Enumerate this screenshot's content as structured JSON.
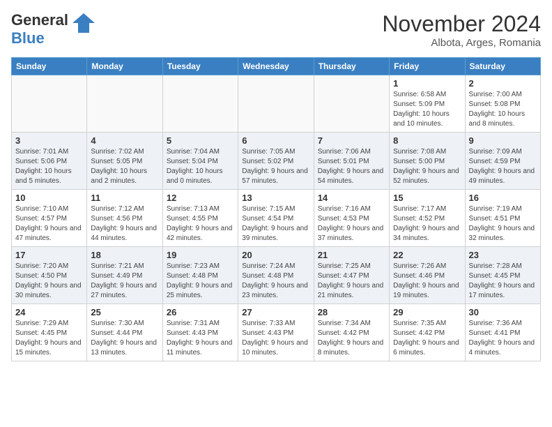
{
  "header": {
    "logo_general": "General",
    "logo_blue": "Blue",
    "month_title": "November 2024",
    "location": "Albota, Arges, Romania"
  },
  "days_of_week": [
    "Sunday",
    "Monday",
    "Tuesday",
    "Wednesday",
    "Thursday",
    "Friday",
    "Saturday"
  ],
  "weeks": [
    {
      "days": [
        {
          "number": "",
          "info": ""
        },
        {
          "number": "",
          "info": ""
        },
        {
          "number": "",
          "info": ""
        },
        {
          "number": "",
          "info": ""
        },
        {
          "number": "",
          "info": ""
        },
        {
          "number": "1",
          "info": "Sunrise: 6:58 AM\nSunset: 5:09 PM\nDaylight: 10 hours and 10 minutes."
        },
        {
          "number": "2",
          "info": "Sunrise: 7:00 AM\nSunset: 5:08 PM\nDaylight: 10 hours and 8 minutes."
        }
      ]
    },
    {
      "days": [
        {
          "number": "3",
          "info": "Sunrise: 7:01 AM\nSunset: 5:06 PM\nDaylight: 10 hours and 5 minutes."
        },
        {
          "number": "4",
          "info": "Sunrise: 7:02 AM\nSunset: 5:05 PM\nDaylight: 10 hours and 2 minutes."
        },
        {
          "number": "5",
          "info": "Sunrise: 7:04 AM\nSunset: 5:04 PM\nDaylight: 10 hours and 0 minutes."
        },
        {
          "number": "6",
          "info": "Sunrise: 7:05 AM\nSunset: 5:02 PM\nDaylight: 9 hours and 57 minutes."
        },
        {
          "number": "7",
          "info": "Sunrise: 7:06 AM\nSunset: 5:01 PM\nDaylight: 9 hours and 54 minutes."
        },
        {
          "number": "8",
          "info": "Sunrise: 7:08 AM\nSunset: 5:00 PM\nDaylight: 9 hours and 52 minutes."
        },
        {
          "number": "9",
          "info": "Sunrise: 7:09 AM\nSunset: 4:59 PM\nDaylight: 9 hours and 49 minutes."
        }
      ]
    },
    {
      "days": [
        {
          "number": "10",
          "info": "Sunrise: 7:10 AM\nSunset: 4:57 PM\nDaylight: 9 hours and 47 minutes."
        },
        {
          "number": "11",
          "info": "Sunrise: 7:12 AM\nSunset: 4:56 PM\nDaylight: 9 hours and 44 minutes."
        },
        {
          "number": "12",
          "info": "Sunrise: 7:13 AM\nSunset: 4:55 PM\nDaylight: 9 hours and 42 minutes."
        },
        {
          "number": "13",
          "info": "Sunrise: 7:15 AM\nSunset: 4:54 PM\nDaylight: 9 hours and 39 minutes."
        },
        {
          "number": "14",
          "info": "Sunrise: 7:16 AM\nSunset: 4:53 PM\nDaylight: 9 hours and 37 minutes."
        },
        {
          "number": "15",
          "info": "Sunrise: 7:17 AM\nSunset: 4:52 PM\nDaylight: 9 hours and 34 minutes."
        },
        {
          "number": "16",
          "info": "Sunrise: 7:19 AM\nSunset: 4:51 PM\nDaylight: 9 hours and 32 minutes."
        }
      ]
    },
    {
      "days": [
        {
          "number": "17",
          "info": "Sunrise: 7:20 AM\nSunset: 4:50 PM\nDaylight: 9 hours and 30 minutes."
        },
        {
          "number": "18",
          "info": "Sunrise: 7:21 AM\nSunset: 4:49 PM\nDaylight: 9 hours and 27 minutes."
        },
        {
          "number": "19",
          "info": "Sunrise: 7:23 AM\nSunset: 4:48 PM\nDaylight: 9 hours and 25 minutes."
        },
        {
          "number": "20",
          "info": "Sunrise: 7:24 AM\nSunset: 4:48 PM\nDaylight: 9 hours and 23 minutes."
        },
        {
          "number": "21",
          "info": "Sunrise: 7:25 AM\nSunset: 4:47 PM\nDaylight: 9 hours and 21 minutes."
        },
        {
          "number": "22",
          "info": "Sunrise: 7:26 AM\nSunset: 4:46 PM\nDaylight: 9 hours and 19 minutes."
        },
        {
          "number": "23",
          "info": "Sunrise: 7:28 AM\nSunset: 4:45 PM\nDaylight: 9 hours and 17 minutes."
        }
      ]
    },
    {
      "days": [
        {
          "number": "24",
          "info": "Sunrise: 7:29 AM\nSunset: 4:45 PM\nDaylight: 9 hours and 15 minutes."
        },
        {
          "number": "25",
          "info": "Sunrise: 7:30 AM\nSunset: 4:44 PM\nDaylight: 9 hours and 13 minutes."
        },
        {
          "number": "26",
          "info": "Sunrise: 7:31 AM\nSunset: 4:43 PM\nDaylight: 9 hours and 11 minutes."
        },
        {
          "number": "27",
          "info": "Sunrise: 7:33 AM\nSunset: 4:43 PM\nDaylight: 9 hours and 10 minutes."
        },
        {
          "number": "28",
          "info": "Sunrise: 7:34 AM\nSunset: 4:42 PM\nDaylight: 9 hours and 8 minutes."
        },
        {
          "number": "29",
          "info": "Sunrise: 7:35 AM\nSunset: 4:42 PM\nDaylight: 9 hours and 6 minutes."
        },
        {
          "number": "30",
          "info": "Sunrise: 7:36 AM\nSunset: 4:41 PM\nDaylight: 9 hours and 4 minutes."
        }
      ]
    }
  ]
}
